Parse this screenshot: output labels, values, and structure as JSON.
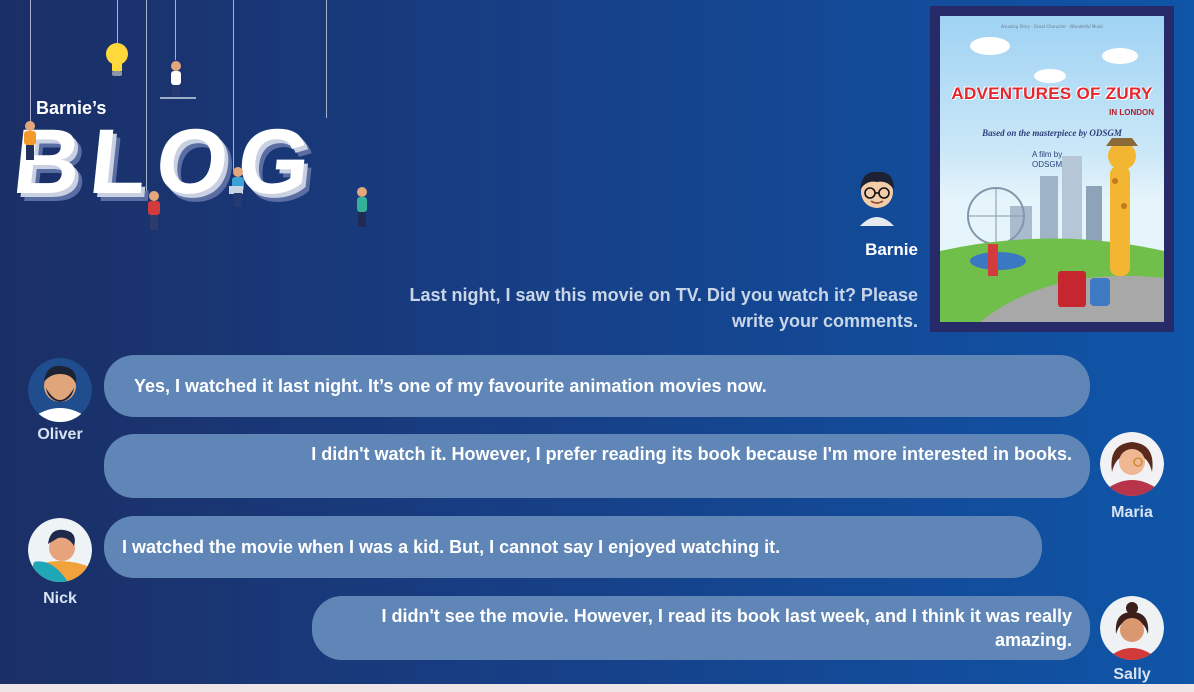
{
  "logo": {
    "subtitle": "Barnie’s",
    "word": "BLOG"
  },
  "poster": {
    "tagline": "Amazing Story · Great Character · Wonderful Music",
    "title": "ADVENTURES OF ZURY",
    "subtitle": "IN LONDON",
    "credit": "Based on the masterpiece by ODSGM",
    "by_line1": "A film by",
    "by_line2": "ODSGM"
  },
  "barnie": {
    "name": "Barnie",
    "message": "Last night, I saw this movie on TV. Did you watch it? Please write your comments."
  },
  "comments": [
    {
      "name": "Oliver",
      "text": "Yes, I watched it last night. It’s one of my favourite animation movies now."
    },
    {
      "name": "Maria",
      "text": "I didn't watch it. However, I prefer reading its book because I'm more interested in books."
    },
    {
      "name": "Nick",
      "text": "I watched the movie when I was a kid. But, I cannot say I enjoyed watching it."
    },
    {
      "name": "Sally",
      "text": "I didn't see the movie. However, I read its book last week, and I think it was really amazing."
    }
  ],
  "colors": {
    "bubble": "#5f86b7",
    "background_left": "#1b2f66",
    "background_right": "#0f55a8",
    "poster_frame": "#262a68",
    "poster_title": "#e4262d"
  }
}
